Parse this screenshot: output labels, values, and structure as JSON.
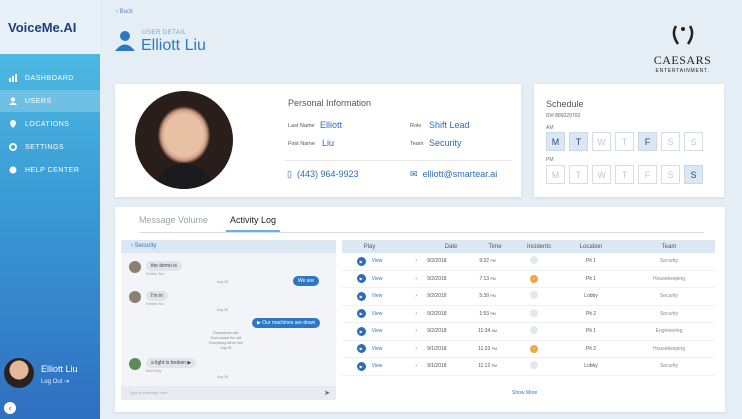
{
  "brand": {
    "logo": "VoiceMe.AI"
  },
  "nav": [
    {
      "label": "DASHBOARD",
      "icon": "dashboard-icon"
    },
    {
      "label": "USERS",
      "icon": "user-icon"
    },
    {
      "label": "LOCATIONS",
      "icon": "location-pin-icon"
    },
    {
      "label": "SETTINGS",
      "icon": "gear-icon"
    },
    {
      "label": "HELP CENTER",
      "icon": "help-icon"
    }
  ],
  "current_user": {
    "name": "Elliott Liu",
    "logout": "Log Out"
  },
  "header": {
    "back": "Back",
    "label": "USER DETAIL",
    "name": "Elliott Liu"
  },
  "company": {
    "name": "CAESARS",
    "sub": "ENTERTAINMENT."
  },
  "personal": {
    "title": "Personal Information",
    "last_name_label": "Last Name",
    "last_name": "Elliott",
    "first_name_label": "First Name",
    "first_name": "Liu",
    "role_label": "Role",
    "role": "Shift Lead",
    "team_label": "Team",
    "team": "Security",
    "phone": "(443) 964-9923",
    "email": "elliott@smartear.ai"
  },
  "schedule": {
    "title": "Schedule",
    "id": "ID# 889229703",
    "am_label": "AM",
    "pm_label": "PM",
    "days": [
      "M",
      "T",
      "W",
      "T",
      "F",
      "S",
      "S"
    ],
    "am_on": [
      true,
      true,
      false,
      false,
      true,
      false,
      false
    ],
    "pm_on": [
      false,
      false,
      false,
      false,
      false,
      false,
      true
    ]
  },
  "tabs": [
    "Message Volume",
    "Activity Log"
  ],
  "chat": {
    "channel": "Security",
    "m1": "the demo is",
    "m1_sub": "Robbie Sun",
    "m1_time": "Aug 28",
    "out1": "We are",
    "m2": "I'm in",
    "m2_sub": "Robbie Sun",
    "m2_time": "Aug 28",
    "out2": "Our machines are down",
    "sys1": "Receipients call.",
    "sys2": "Dont cancel the call",
    "sys3": "Everything will be fine",
    "sys_time": "Aug 28",
    "m3": "a light is broken",
    "m3_sub": "Wolf Grey",
    "m3_time": "Aug 28",
    "input_placeholder": "Type a message here"
  },
  "table": {
    "headers": [
      "Play",
      "Date",
      "Time",
      "Incidents",
      "Location",
      "Team"
    ],
    "view_label": "View",
    "rows": [
      {
        "date": "9/2/2018",
        "time": "9:22",
        "ampm": "PM",
        "incident": false,
        "location": "Pit 1",
        "team": "Security"
      },
      {
        "date": "9/2/2018",
        "time": "7:13",
        "ampm": "PM",
        "incident": true,
        "location": "Pit 1",
        "team": "Housekeeping"
      },
      {
        "date": "9/2/2018",
        "time": "5:39",
        "ampm": "PM",
        "incident": false,
        "location": "Lobby",
        "team": "Security"
      },
      {
        "date": "9/2/2018",
        "time": "1:53",
        "ampm": "PM",
        "incident": false,
        "location": "Pit 2",
        "team": "Security"
      },
      {
        "date": "9/2/2018",
        "time": "11:34",
        "ampm": "AM",
        "incident": false,
        "location": "Pit 1",
        "team": "Engineering"
      },
      {
        "date": "9/1/2018",
        "time": "11:33",
        "ampm": "PM",
        "incident": true,
        "location": "Pit 2",
        "team": "Housekeeping"
      },
      {
        "date": "9/1/2018",
        "time": "11:12",
        "ampm": "PM",
        "incident": false,
        "location": "Lobby",
        "team": "Security"
      }
    ],
    "show_more": "Show More"
  }
}
